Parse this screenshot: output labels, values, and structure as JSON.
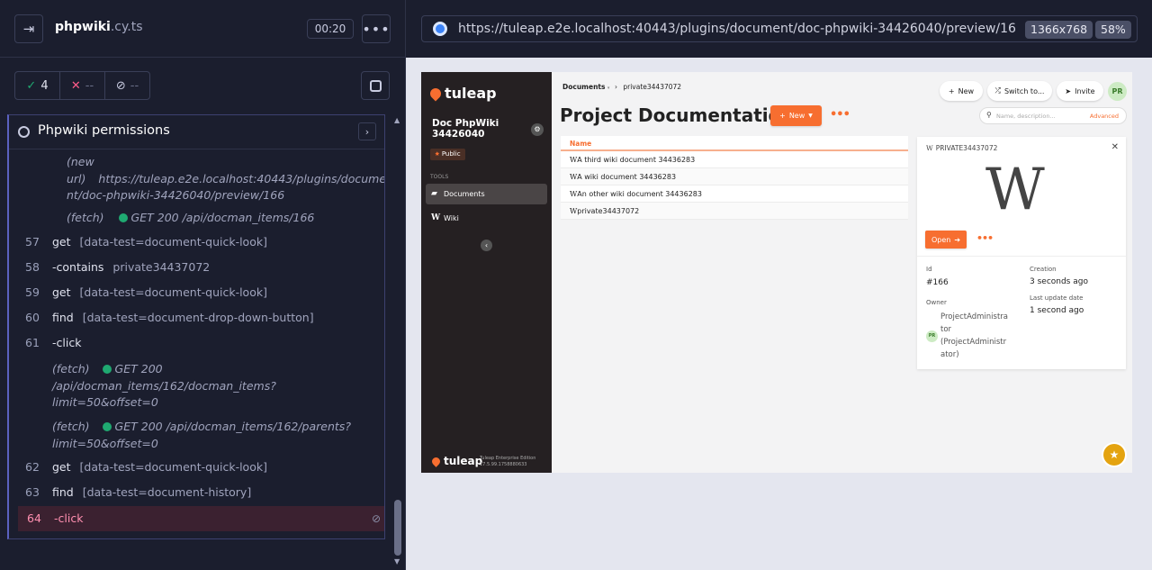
{
  "runner": {
    "spec_name": "phpwiki",
    "spec_ext": ".cy.ts",
    "timer": "00:20",
    "stats": {
      "passed": "4",
      "failed": "--",
      "pending": "--"
    },
    "suite_title": "Phpwiki permissions",
    "log_top": {
      "label1": "(new",
      "label2": "url)",
      "url_line1": "https://tuleap.e2e.localhost:40443/plugins/docume",
      "url_line2": "nt/doc-phpwiki-34426040/preview/166",
      "fetch_label": "(fetch)",
      "fetch_text": "GET 200 /api/docman_items/166"
    },
    "commands": [
      {
        "num": "57",
        "cmd": "get",
        "arg": "[data-test=document-quick-look]"
      },
      {
        "num": "58",
        "cmd": "-contains",
        "arg": "private34437072"
      },
      {
        "num": "59",
        "cmd": "get",
        "arg": "[data-test=document-quick-look]"
      },
      {
        "num": "60",
        "cmd": "find",
        "arg": "[data-test=document-drop-down-button]"
      },
      {
        "num": "61",
        "cmd": "-click",
        "arg": ""
      },
      {
        "num": "62",
        "cmd": "get",
        "arg": "[data-test=document-quick-look]"
      },
      {
        "num": "63",
        "cmd": "find",
        "arg": "[data-test=document-history]"
      },
      {
        "num": "64",
        "cmd": "-click",
        "arg": ""
      }
    ],
    "fetch1": {
      "label": "(fetch)",
      "line1": "GET 200",
      "line2": "/api/docman_items/162/docman_items?",
      "line3": "limit=50&offset=0"
    },
    "fetch2": {
      "label": "(fetch)",
      "line1": "GET 200 /api/docman_items/162/parents?",
      "line2": "limit=50&offset=0"
    }
  },
  "browser": {
    "url": "https://tuleap.e2e.localhost:40443/plugins/document/doc-phpwiki-34426040/preview/166",
    "viewport": "1366x768",
    "zoom": "58%"
  },
  "tuleap": {
    "logo": "tuleap",
    "project_name": "Doc PhpWiki 34426040",
    "visibility": "Public",
    "tools_label": "TOOLS",
    "nav": [
      {
        "label": "Documents"
      },
      {
        "label": "Wiki"
      }
    ],
    "footer_edition": "Tuleap Enterprise Edition",
    "footer_version": "17.5.99.1758880633",
    "breadcrumb_root": "Documents",
    "breadcrumb_folder": "private34437072",
    "header_buttons": {
      "new": "New",
      "switch": "Switch to...",
      "invite": "Invite",
      "avatar": "PR"
    },
    "search_placeholder": "Name, description...",
    "search_advanced": "Advanced",
    "page_title": "Project Documentation",
    "new_button": "New",
    "table_header": "Name",
    "items": [
      {
        "name": "A third wiki document 34436283"
      },
      {
        "name": "A wiki document 34436283"
      },
      {
        "name": "An other wiki document 34436283"
      },
      {
        "name": "private34437072"
      }
    ],
    "quicklook": {
      "title": "PRIVATE34437072",
      "open_label": "Open",
      "id_label": "Id",
      "id_value": "#166",
      "creation_label": "Creation",
      "creation_value": "3 seconds ago",
      "owner_label": "Owner",
      "owner_line1": "ProjectAdministra",
      "owner_line2": "tor",
      "owner_line3": "(ProjectAdministr",
      "owner_line4": "ator)",
      "owner_avatar": "PR",
      "update_label": "Last update date",
      "update_value": "1 second ago"
    }
  }
}
